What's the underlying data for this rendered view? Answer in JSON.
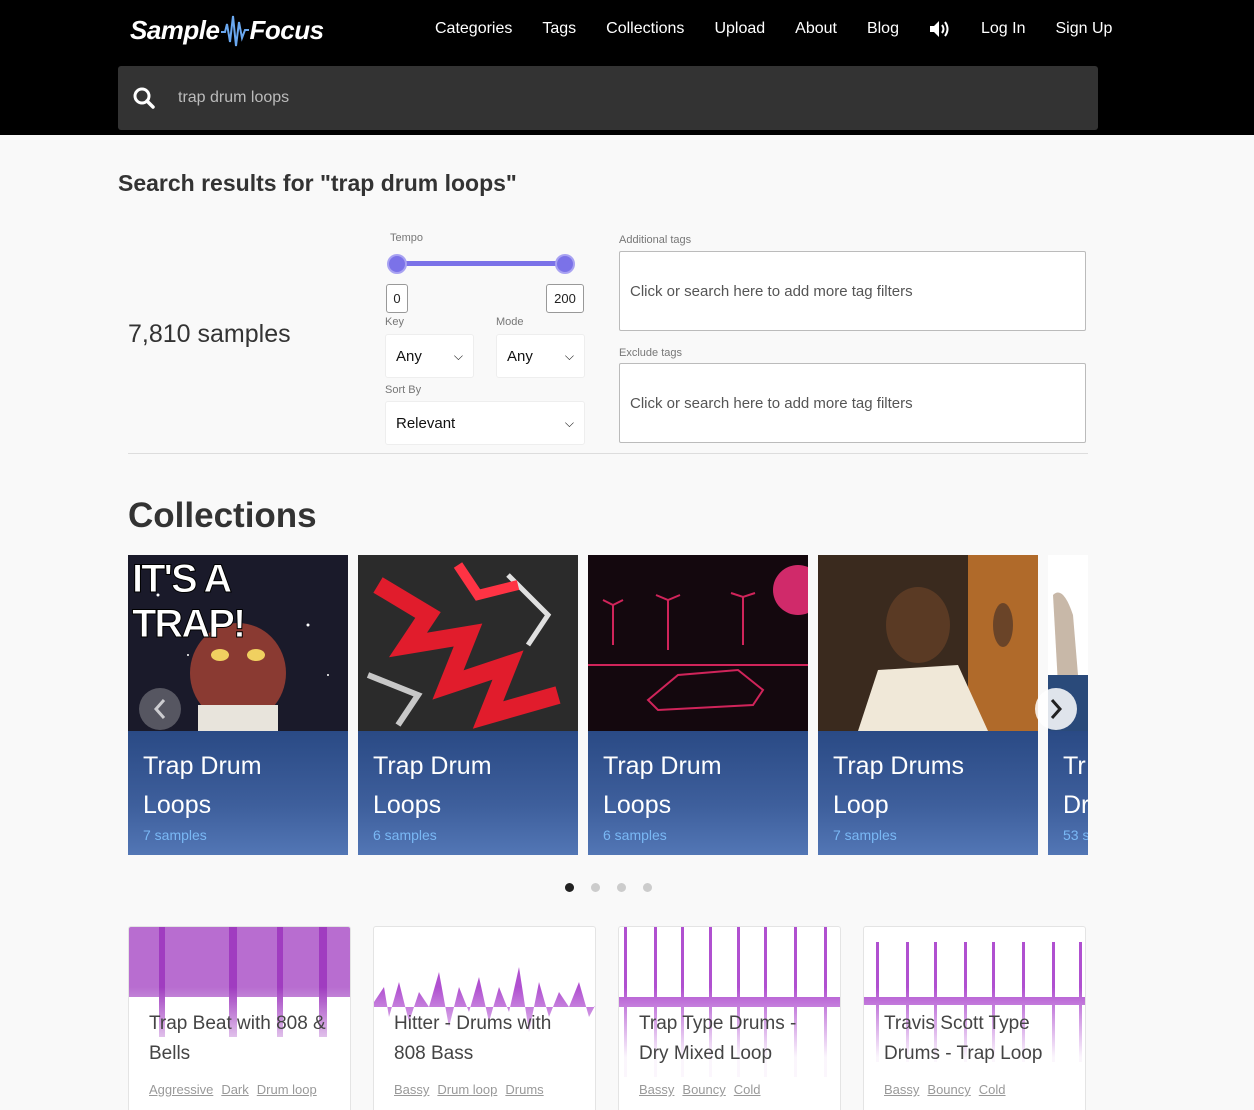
{
  "brand": {
    "name_left": "Sample",
    "name_right": "Focus"
  },
  "nav": {
    "items": [
      "Categories",
      "Tags",
      "Collections",
      "Upload",
      "About",
      "Blog"
    ],
    "login": "Log In",
    "signup": "Sign Up"
  },
  "search": {
    "value": "trap drum loops"
  },
  "results": {
    "title": "Search results for \"trap drum loops\"",
    "count": "7,810 samples"
  },
  "filters": {
    "tempo_label": "Tempo",
    "tempo_min": "0",
    "tempo_max": "200",
    "key_label": "Key",
    "key_value": "Any",
    "mode_label": "Mode",
    "mode_value": "Any",
    "sort_label": "Sort By",
    "sort_value": "Relevant",
    "additional_tags_label": "Additional tags",
    "additional_tags_placeholder": "Click or search here to add more tag filters",
    "exclude_tags_label": "Exclude tags",
    "exclude_tags_placeholder": "Click or search here to add more tag filters"
  },
  "collections": {
    "title": "Collections",
    "overlay_text": "IT'S A TRAP!",
    "cards": [
      {
        "line1": "Trap Drum",
        "line2": "Loops",
        "count": "7 samples"
      },
      {
        "line1": "Trap Drum",
        "line2": "Loops",
        "count": "6 samples"
      },
      {
        "line1": "Trap Drum",
        "line2": "Loops",
        "count": "6 samples"
      },
      {
        "line1": "Trap Drums",
        "line2": "Loop",
        "count": "7 samples"
      },
      {
        "line1": "Tr",
        "line2": "Dr",
        "count": "53 s"
      }
    ],
    "dots": 4,
    "active_dot": 0
  },
  "samples": [
    {
      "title": "Trap Beat with 808 & Bells",
      "tags": [
        "Aggressive",
        "Dark",
        "Drum loop"
      ]
    },
    {
      "title": "Hitter - Drums with 808 Bass",
      "tags": [
        "Bassy",
        "Drum loop",
        "Drums"
      ]
    },
    {
      "title": "Trap Type Drums - Dry Mixed Loop",
      "tags": [
        "Bassy",
        "Bouncy",
        "Cold"
      ]
    },
    {
      "title": "Travis Scott Type Drums - Trap Loop",
      "tags": [
        "Bassy",
        "Bouncy",
        "Cold"
      ]
    }
  ],
  "colors": {
    "header_bg": "#000000",
    "search_bg": "#333333",
    "slider": "#7b72e8",
    "card_blue": "#2a4a85",
    "card_count": "#7ab8f5",
    "waveform": "#a03cc0"
  }
}
